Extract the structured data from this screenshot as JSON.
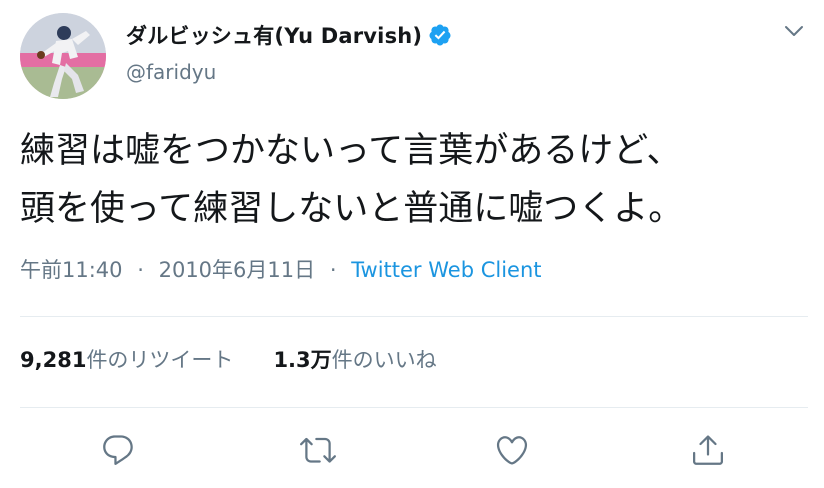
{
  "user": {
    "display_name": "ダルビッシュ有(Yu Darvish)",
    "handle": "@faridyu",
    "verified": true,
    "avatar_icon": "avatar-photo"
  },
  "tweet": {
    "lines": [
      "練習は嘘をつかないって言葉があるけど、",
      "頭を使って練習しないと普通に嘘つくよ。"
    ],
    "time": "午前11:40",
    "date": "2010年6月11日",
    "separator": "·",
    "source": "Twitter Web Client"
  },
  "stats": {
    "retweets_count": "9,281",
    "retweets_label": "件のリツイート",
    "likes_count": "1.3万",
    "likes_label": "件のいいね"
  },
  "actions": {
    "reply_icon": "reply-icon",
    "retweet_icon": "retweet-icon",
    "like_icon": "heart-icon",
    "share_icon": "share-icon"
  },
  "colors": {
    "text": "#14171a",
    "secondary": "#657786",
    "link": "#1b95e0",
    "verified": "#1da1f2",
    "divider": "#e6ecf0"
  }
}
